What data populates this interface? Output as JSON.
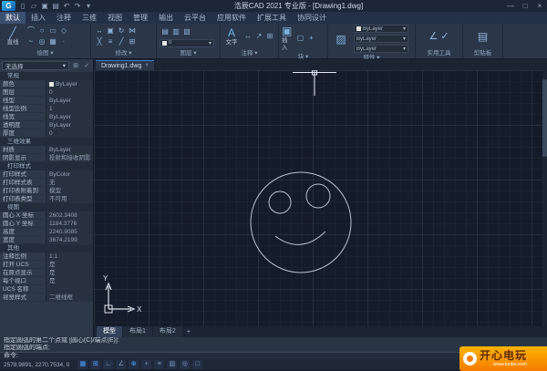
{
  "colors": {
    "accent_blue": "#3d7cc9",
    "ribbon_bg": "#2b3749",
    "canvas_bg": "#151c29",
    "watermark_orange": "#f57c00"
  },
  "window": {
    "title": "浩辰CAD 2021 专业版 - [Drawing1.dwg]",
    "minimize": "—",
    "maximize": "□",
    "close": "×"
  },
  "quick_access": {
    "logo": "G",
    "new": "▯",
    "open": "▱",
    "save": "▣",
    "plot": "▤",
    "undo": "↶",
    "redo": "↷",
    "more": "▾"
  },
  "ribbon": {
    "caret": "▾",
    "tabs": [
      "默认",
      "插入",
      "注释",
      "三维",
      "视图",
      "管理",
      "输出",
      "云平台",
      "应用软件",
      "扩展工具",
      "协同设计"
    ],
    "draw": {
      "label": "绘图",
      "line_glyph": "╱",
      "line_label": "直线",
      "tools": {
        "arc": "⌒",
        "circle": "○",
        "rect": "▭",
        "polygon": "◇",
        "spline": "~",
        "ellipse": "◎",
        "hatch": "▦",
        "point": "·"
      }
    },
    "modify": {
      "label": "修改",
      "tools": {
        "move": "↔",
        "copy": "▣",
        "rotate": "↻",
        "mirror": "⋈",
        "erase": "╳",
        "offset": "≡",
        "trim": "╱",
        "array": "⊞"
      }
    },
    "layers": {
      "label": "图层",
      "tools": {
        "list": "▤",
        "state": "▥",
        "isolate": "▧"
      },
      "dropdown": {
        "value": "0"
      }
    },
    "annotation": {
      "label": "注释",
      "text_glyph": "A",
      "text_label": "文字",
      "tools": {
        "dimension": "↔",
        "leader": "↗",
        "table": "⊞"
      }
    },
    "block": {
      "label": "块",
      "insert_glyph": "▣",
      "insert_label": "插入",
      "tools": {
        "create": "▢",
        "edit": "+"
      }
    },
    "props": {
      "label": "特性",
      "match_glyph": "▨",
      "rows": {
        "color": "ByLayer",
        "linetype": "ByLayer",
        "lineweight": "ByLayer"
      }
    },
    "utils": {
      "label": "实用工具",
      "tools": {
        "measure": "∠",
        "qselect": "✓"
      }
    },
    "clipboard": {
      "label": "剪贴板",
      "paste_glyph": "▤"
    }
  },
  "palette": {
    "selection": "无选择",
    "caret": "▾",
    "icon_toggle": "⊞",
    "icon_quick": "✓",
    "sections": [
      {
        "title": "常规",
        "rows": [
          {
            "label": "颜色",
            "value": "ByLayer"
          },
          {
            "label": "图层",
            "value": "0"
          },
          {
            "label": "线型",
            "value": "ByLayer"
          },
          {
            "label": "线型比例",
            "value": "1"
          },
          {
            "label": "线宽",
            "value": "ByLayer"
          },
          {
            "label": "透明度",
            "value": "ByLayer"
          },
          {
            "label": "厚度",
            "value": "0"
          }
        ]
      },
      {
        "title": "三维效果",
        "rows": [
          {
            "label": "材质",
            "value": "ByLayer"
          },
          {
            "label": "阴影显示",
            "value": "投射和接收阴影"
          }
        ]
      },
      {
        "title": "打印样式",
        "rows": [
          {
            "label": "打印样式",
            "value": "ByColor"
          },
          {
            "label": "打印样式表",
            "value": "无"
          },
          {
            "label": "打印表附着到",
            "value": "模型"
          },
          {
            "label": "打印表类型",
            "value": "不可用"
          }
        ]
      },
      {
        "title": "视图",
        "rows": [
          {
            "label": "圆心 X 坐标",
            "value": "2602.3408"
          },
          {
            "label": "圆心 Y 坐标",
            "value": "1184.3776"
          },
          {
            "label": "高度",
            "value": "2240.9085"
          },
          {
            "label": "宽度",
            "value": "3674.2199"
          }
        ]
      },
      {
        "title": "其他",
        "rows": [
          {
            "label": "注释比例",
            "value": "1:1"
          },
          {
            "label": "打开 UCS",
            "value": "是"
          },
          {
            "label": "在原点显示",
            "value": "是"
          },
          {
            "label": "每个视口",
            "value": "是"
          },
          {
            "label": "UCS 名称",
            "value": ""
          },
          {
            "label": "视觉样式",
            "value": "二维线框"
          }
        ]
      }
    ]
  },
  "drawing": {
    "file_tab": "Drawing1.dwg",
    "file_tab_close": "×",
    "ucs_x": "X",
    "ucs_y": "Y",
    "layout_tabs": [
      "模型",
      "布局1",
      "布局2"
    ],
    "layout_add": "+"
  },
  "command": {
    "history": [
      "指定圆弧的第二个点或 [圆心(C)/端点(E)]:",
      "指定圆弧的端点:"
    ],
    "prompt": "命令:"
  },
  "status": {
    "coords": "2578.9891, 2270.7534, 0",
    "icons": {
      "snap": "▦",
      "grid": "⊞",
      "ortho": "∟",
      "polar": "∠",
      "osnap": "⊕",
      "otrack": "+",
      "lineweight": "≡",
      "transparency": "▨",
      "cycle": "◎",
      "fullscreen": "□"
    }
  },
  "watermark": {
    "name": "开心电玩",
    "url": "www.kxdw.com"
  }
}
